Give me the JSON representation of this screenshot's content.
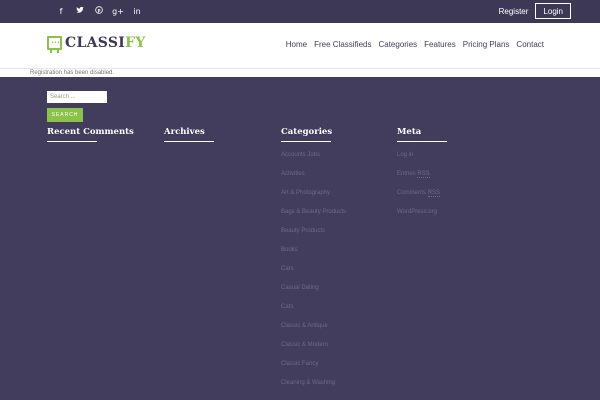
{
  "topbar": {
    "social_icons": [
      {
        "name": "facebook-icon",
        "glyph": "f"
      },
      {
        "name": "twitter-icon",
        "glyph": " 🐦"
      },
      {
        "name": "pinterest-icon",
        "glyph": "℗"
      },
      {
        "name": "google-plus-icon",
        "glyph": "g+"
      },
      {
        "name": "linkedin-icon",
        "glyph": "in"
      }
    ],
    "register_label": "Register",
    "login_label": "Login"
  },
  "header": {
    "logo_main": "CLASSI",
    "logo_accent": "FY",
    "nav": [
      "Home",
      "Free Classifieds",
      "Categories",
      "Features",
      "Pricing Plans",
      "Contact"
    ]
  },
  "notice": {
    "text": "Registration has been disabled."
  },
  "search": {
    "placeholder": "Search ...",
    "button_label": "SEARCH"
  },
  "widgets": {
    "recent_comments": {
      "title": "Recent Comments"
    },
    "archives": {
      "title": "Archives"
    },
    "categories": {
      "title": "Categories",
      "items": [
        "Accounts Jobs",
        "Activities",
        "Art & Photography",
        "Bags & Beauty Products",
        "Beauty Products",
        "Books",
        "Cars",
        "Casual Dating",
        "Cats",
        "Classic & Antique",
        "Classic & Modern",
        "Classic Fancy",
        "Cleaning & Washing"
      ]
    },
    "meta": {
      "title": "Meta",
      "items": [
        {
          "prefix": "Log in",
          "abbr": ""
        },
        {
          "prefix": "Entries ",
          "abbr": "RSS"
        },
        {
          "prefix": "Comments ",
          "abbr": "RSS"
        },
        {
          "prefix": "WordPress.org",
          "abbr": ""
        }
      ]
    }
  },
  "colors": {
    "page_bg": "#433d5d",
    "topbar_bg": "#3d3856",
    "accent": "#8bc34a",
    "link_muted": "#6f6987"
  }
}
